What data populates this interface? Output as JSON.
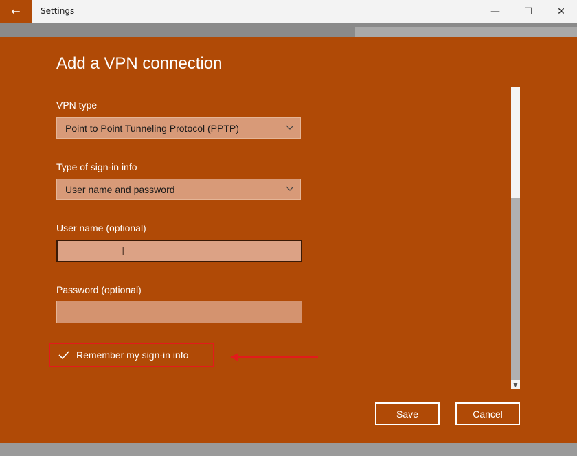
{
  "window": {
    "title": "Settings",
    "back_glyph": "←",
    "minimize_glyph": "—",
    "maximize_glyph": "☐",
    "close_glyph": "✕"
  },
  "dialog": {
    "title": "Add a VPN connection",
    "vpn_type": {
      "label": "VPN type",
      "value": "Point to Point Tunneling Protocol (PPTP)"
    },
    "signin_type": {
      "label": "Type of sign-in info",
      "value": "User name and password"
    },
    "username": {
      "label": "User name (optional)",
      "value": ""
    },
    "password": {
      "label": "Password (optional)",
      "value": ""
    },
    "remember": {
      "label": "Remember my sign-in info",
      "checked": true
    },
    "buttons": {
      "save": "Save",
      "cancel": "Cancel"
    },
    "scroll": {
      "up_glyph": "▲",
      "down_glyph": "▼"
    }
  },
  "colors": {
    "accent": "#b04a06",
    "annotation": "#e21b1b"
  }
}
